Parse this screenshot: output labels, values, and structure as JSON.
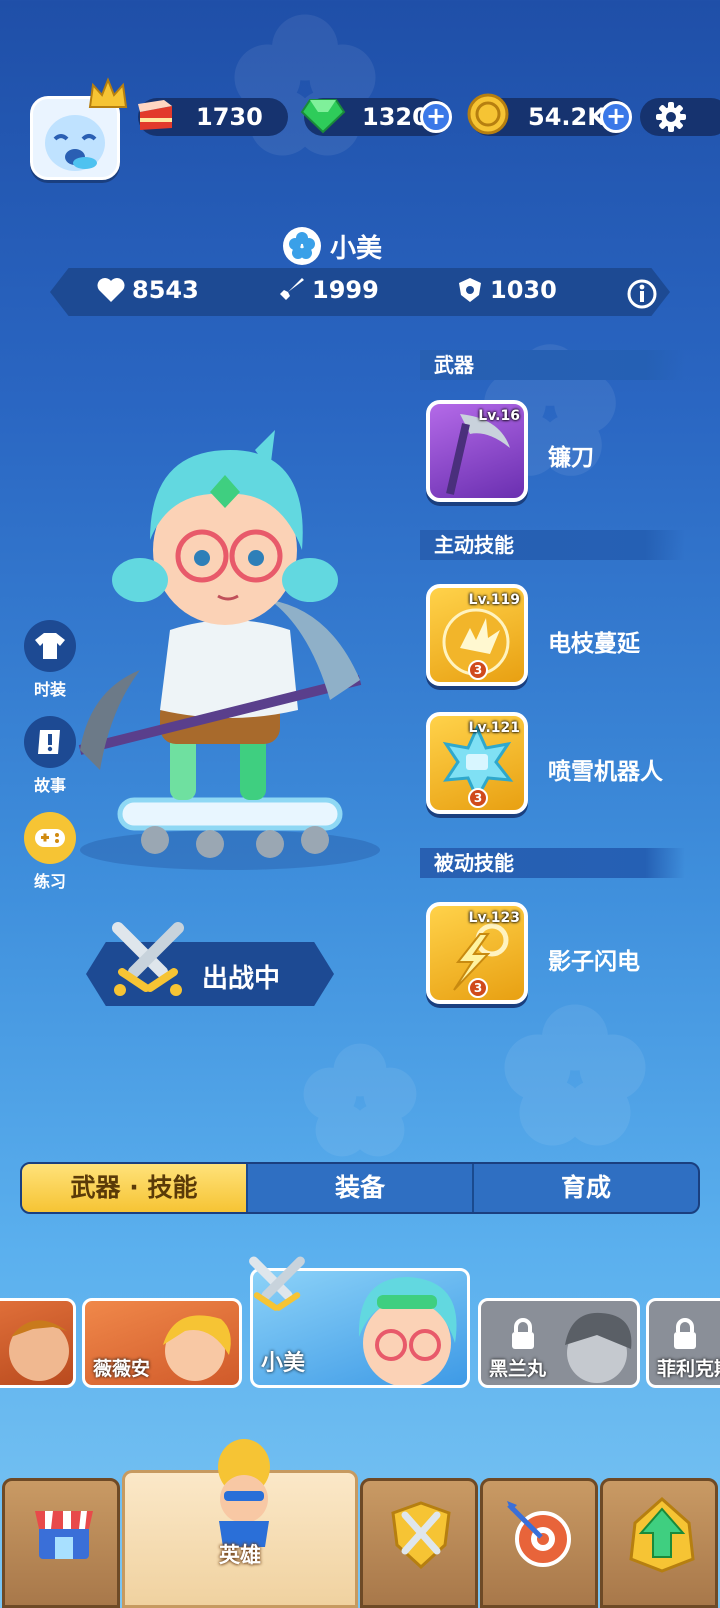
{
  "resources": {
    "cake": "1730",
    "gems": "1320",
    "coins": "54.2K",
    "plus": "+"
  },
  "hero": {
    "name": "小美",
    "stats": {
      "hp": "8543",
      "attack": "1999",
      "defense": "1030"
    }
  },
  "sections": {
    "weapon": "武器",
    "active": "主动技能",
    "passive": "被动技能"
  },
  "skills": [
    {
      "level": "Lv.16",
      "name": "镰刀",
      "badge": ""
    },
    {
      "level": "Lv.119",
      "name": "电枝蔓延",
      "badge": "3"
    },
    {
      "level": "Lv.121",
      "name": "喷雪机器人",
      "badge": "3"
    },
    {
      "level": "Lv.123",
      "name": "影子闪电",
      "badge": "3"
    }
  ],
  "side_buttons": [
    "时装",
    "故事",
    "练习"
  ],
  "deploy_label": "出战中",
  "tabs": [
    "武器 · 技能",
    "装备",
    "育成"
  ],
  "roster": [
    {
      "name": ""
    },
    {
      "name": "薇薇安"
    },
    {
      "name": "小美"
    },
    {
      "name": "黑兰丸"
    },
    {
      "name": "菲利克斯"
    }
  ],
  "nav": {
    "hero_label": "英雄"
  },
  "colors": {
    "accent_gold": "#f6c434",
    "panel_dark": "#16336f",
    "gem_green": "#2ecc5a"
  }
}
